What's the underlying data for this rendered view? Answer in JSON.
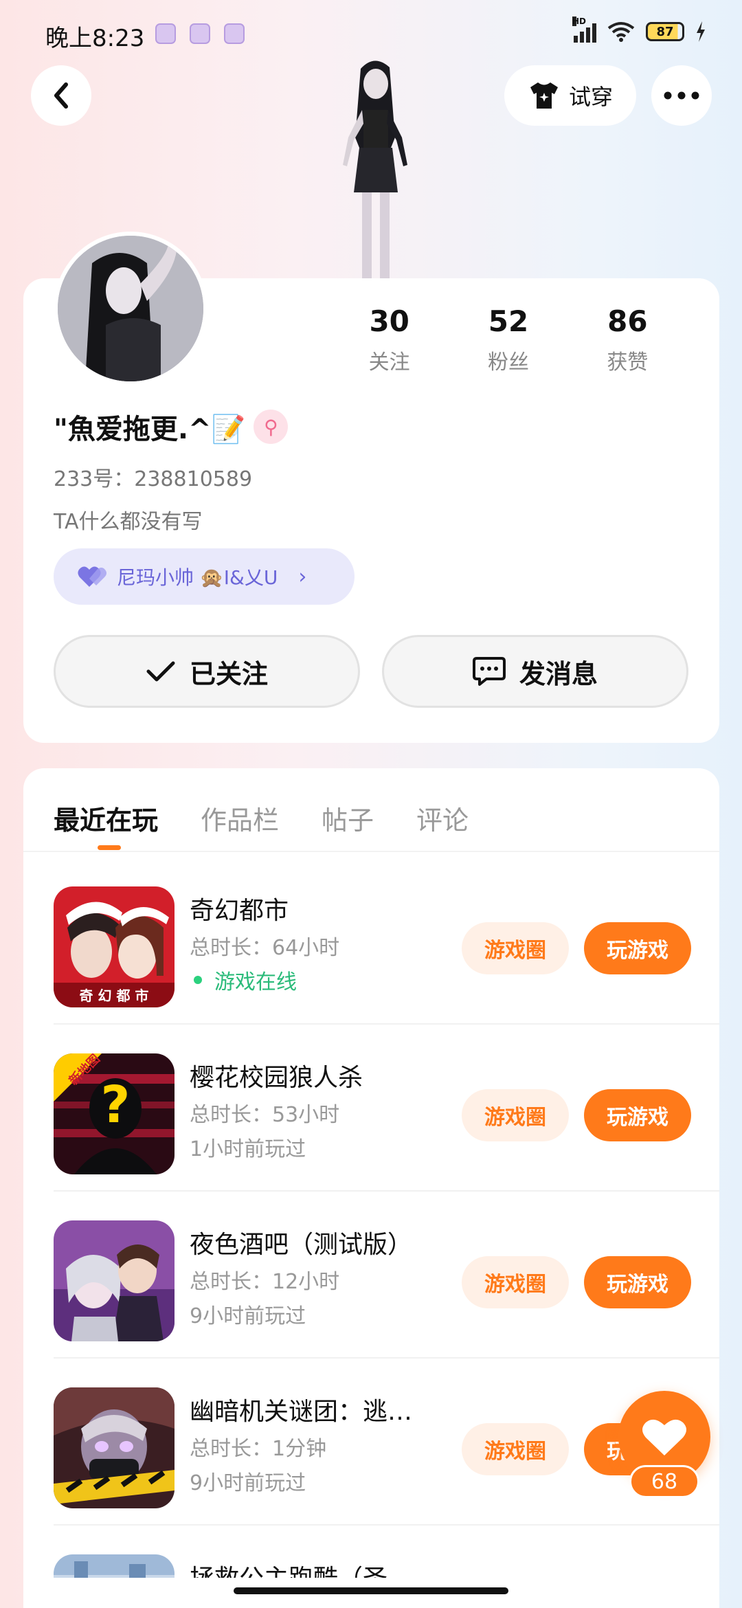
{
  "status_bar": {
    "time": "晚上8:23",
    "battery": "87",
    "hd": "HD"
  },
  "header": {
    "try_on_label": "试穿"
  },
  "profile": {
    "stats": [
      {
        "num": "30",
        "label": "关注"
      },
      {
        "num": "52",
        "label": "粉丝"
      },
      {
        "num": "86",
        "label": "获赞"
      }
    ],
    "nickname": "\"魚爱拖更.^📝",
    "gender_symbol": "⚲",
    "account_id": "233号：238810589",
    "bio": "TA什么都没有写",
    "relation_chip": "尼玛小帅 🙊I&乂U",
    "follow_label": "已关注",
    "message_label": "发消息"
  },
  "tabs": [
    "最近在玩",
    "作品栏",
    "帖子",
    "评论"
  ],
  "games": [
    {
      "title": "奇幻都市",
      "duration": "总时长：64小时",
      "status": "游戏在线",
      "online": true,
      "icon_text": "奇 幻 都 市"
    },
    {
      "title": "樱花校园狼人杀",
      "duration": "总时长：53小时",
      "status": "1小时前玩过",
      "online": false,
      "icon_text": "新地图"
    },
    {
      "title": "夜色酒吧（测试版）",
      "duration": "总时长：12小时",
      "status": "9小时前玩过",
      "online": false
    },
    {
      "title": "幽暗机关谜团：逃…",
      "duration": "总时长：1分钟",
      "status": "9小时前玩过",
      "online": false
    },
    {
      "title": "拯救公主跑酷（圣",
      "duration": "",
      "status": "",
      "online": false
    }
  ],
  "game_buttons": {
    "circle_label": "游戏圈",
    "play_label": "玩游戏"
  },
  "like": {
    "count": "68"
  },
  "colors": {
    "accent": "#ff7a1a",
    "online": "#2bbb7a",
    "chip": "#6a65d8"
  }
}
